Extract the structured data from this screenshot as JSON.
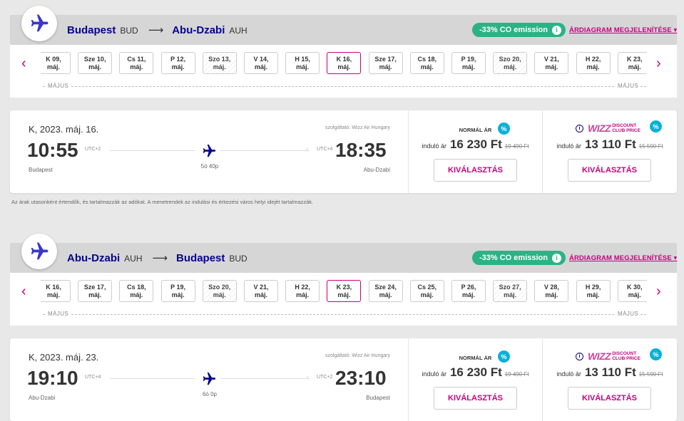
{
  "disclaimer": "Az árak utasonként értendők, és tartalmazzák az adókat. A menetrendek az indulási és érkezési város helyi idejét tartalmazzák.",
  "sections": [
    {
      "route": {
        "from_city": "Budapest",
        "from_code": "BUD",
        "arrow": "⟶",
        "to_city": "Abu-Dzabi",
        "to_code": "AUH"
      },
      "co_badge": "-33% CO emission",
      "chart_link": "ÁRDIAGRAM MEGJELENÍTÉSE ▾",
      "month_left": "MÁJUS",
      "month_right": "MÁJUS",
      "days": [
        {
          "day": "K 09,",
          "month": "máj.",
          "dim": false,
          "selected": false
        },
        {
          "day": "Sze 10,",
          "month": "máj.",
          "dim": false,
          "selected": false
        },
        {
          "day": "Cs 11,",
          "month": "máj.",
          "dim": false,
          "selected": false
        },
        {
          "day": "P 12,",
          "month": "máj.",
          "dim": false,
          "selected": false
        },
        {
          "day": "Szo 13,",
          "month": "máj.",
          "dim": true,
          "selected": false
        },
        {
          "day": "V 14,",
          "month": "máj.",
          "dim": false,
          "selected": false
        },
        {
          "day": "H 15,",
          "month": "máj.",
          "dim": false,
          "selected": false
        },
        {
          "day": "K 16,",
          "month": "máj.",
          "dim": false,
          "selected": true
        },
        {
          "day": "Sze 17,",
          "month": "máj.",
          "dim": false,
          "selected": false
        },
        {
          "day": "Cs 18,",
          "month": "máj.",
          "dim": false,
          "selected": false
        },
        {
          "day": "P 19,",
          "month": "máj.",
          "dim": false,
          "selected": false
        },
        {
          "day": "Szo 20,",
          "month": "máj.",
          "dim": true,
          "selected": false
        },
        {
          "day": "V 21,",
          "month": "máj.",
          "dim": false,
          "selected": false
        },
        {
          "day": "H 22,",
          "month": "máj.",
          "dim": false,
          "selected": false
        },
        {
          "day": "K 23,",
          "month": "máj.",
          "dim": false,
          "selected": false
        }
      ],
      "flight": {
        "date": "K, 2023. máj. 16.",
        "operator": "szolgáltató: Wizz Air Hungary",
        "dep_time": "10:55",
        "dep_tz": "UTC+2",
        "dep_city": "Budapest",
        "arr_time": "18:35",
        "arr_tz": "UTC+4",
        "arr_city": "Abu-Dzabi",
        "duration": "5ó 40p"
      },
      "prices": {
        "normal_title": "NORMÁL ÁR",
        "from_label": "induló ár",
        "normal_price": "16 230 Ft",
        "normal_old": "19 490 Ft",
        "club_logo": "WIZZ",
        "club_text1": "DISCOUNT",
        "club_text2": "CLUB PRICE",
        "club_price": "13 110 Ft",
        "club_old": "15 590 Ft",
        "select_label": "KIVÁLASZTÁS",
        "pct": "%"
      }
    },
    {
      "route": {
        "from_city": "Abu-Dzabi",
        "from_code": "AUH",
        "arrow": "⟶",
        "to_city": "Budapest",
        "to_code": "BUD"
      },
      "co_badge": "-33% CO emission",
      "chart_link": "ÁRDIAGRAM MEGJELENÍTÉSE ▾",
      "month_left": "MÁJUS",
      "month_right": "MÁJUS",
      "days": [
        {
          "day": "K 16,",
          "month": "máj.",
          "dim": false,
          "selected": false
        },
        {
          "day": "Sze 17,",
          "month": "máj.",
          "dim": false,
          "selected": false
        },
        {
          "day": "Cs 18,",
          "month": "máj.",
          "dim": false,
          "selected": false
        },
        {
          "day": "P 19,",
          "month": "máj.",
          "dim": false,
          "selected": false
        },
        {
          "day": "Szo 20,",
          "month": "máj.",
          "dim": true,
          "selected": false
        },
        {
          "day": "V 21,",
          "month": "máj.",
          "dim": false,
          "selected": false
        },
        {
          "day": "H 22,",
          "month": "máj.",
          "dim": false,
          "selected": false
        },
        {
          "day": "K 23,",
          "month": "máj.",
          "dim": false,
          "selected": true
        },
        {
          "day": "Sze 24,",
          "month": "máj.",
          "dim": false,
          "selected": false
        },
        {
          "day": "Cs 25,",
          "month": "máj.",
          "dim": false,
          "selected": false
        },
        {
          "day": "P 26,",
          "month": "máj.",
          "dim": false,
          "selected": false
        },
        {
          "day": "Szo 27,",
          "month": "máj.",
          "dim": true,
          "selected": false
        },
        {
          "day": "V 28,",
          "month": "máj.",
          "dim": false,
          "selected": false
        },
        {
          "day": "H 29,",
          "month": "máj.",
          "dim": false,
          "selected": false
        },
        {
          "day": "K 30,",
          "month": "máj.",
          "dim": false,
          "selected": false
        }
      ],
      "flight": {
        "date": "K, 2023. máj. 23.",
        "operator": "szolgáltató: Wizz Air Hungary",
        "dep_time": "19:10",
        "dep_tz": "UTC+4",
        "dep_city": "Abu-Dzabi",
        "arr_time": "23:10",
        "arr_tz": "UTC+2",
        "arr_city": "Budapest",
        "duration": "6ó 0p"
      },
      "prices": {
        "normal_title": "NORMÁL ÁR",
        "from_label": "induló ár",
        "normal_price": "16 230 Ft",
        "normal_old": "19 490 Ft",
        "club_logo": "WIZZ",
        "club_text1": "DISCOUNT",
        "club_text2": "CLUB PRICE",
        "club_price": "13 110 Ft",
        "club_old": "15 590 Ft",
        "select_label": "KIVÁLASZTÁS",
        "pct": "%"
      }
    }
  ],
  "colors": {
    "brand": "#06038d",
    "accent": "#c6007e",
    "eco": "#2ab384",
    "pct": "#0ab1d6"
  }
}
